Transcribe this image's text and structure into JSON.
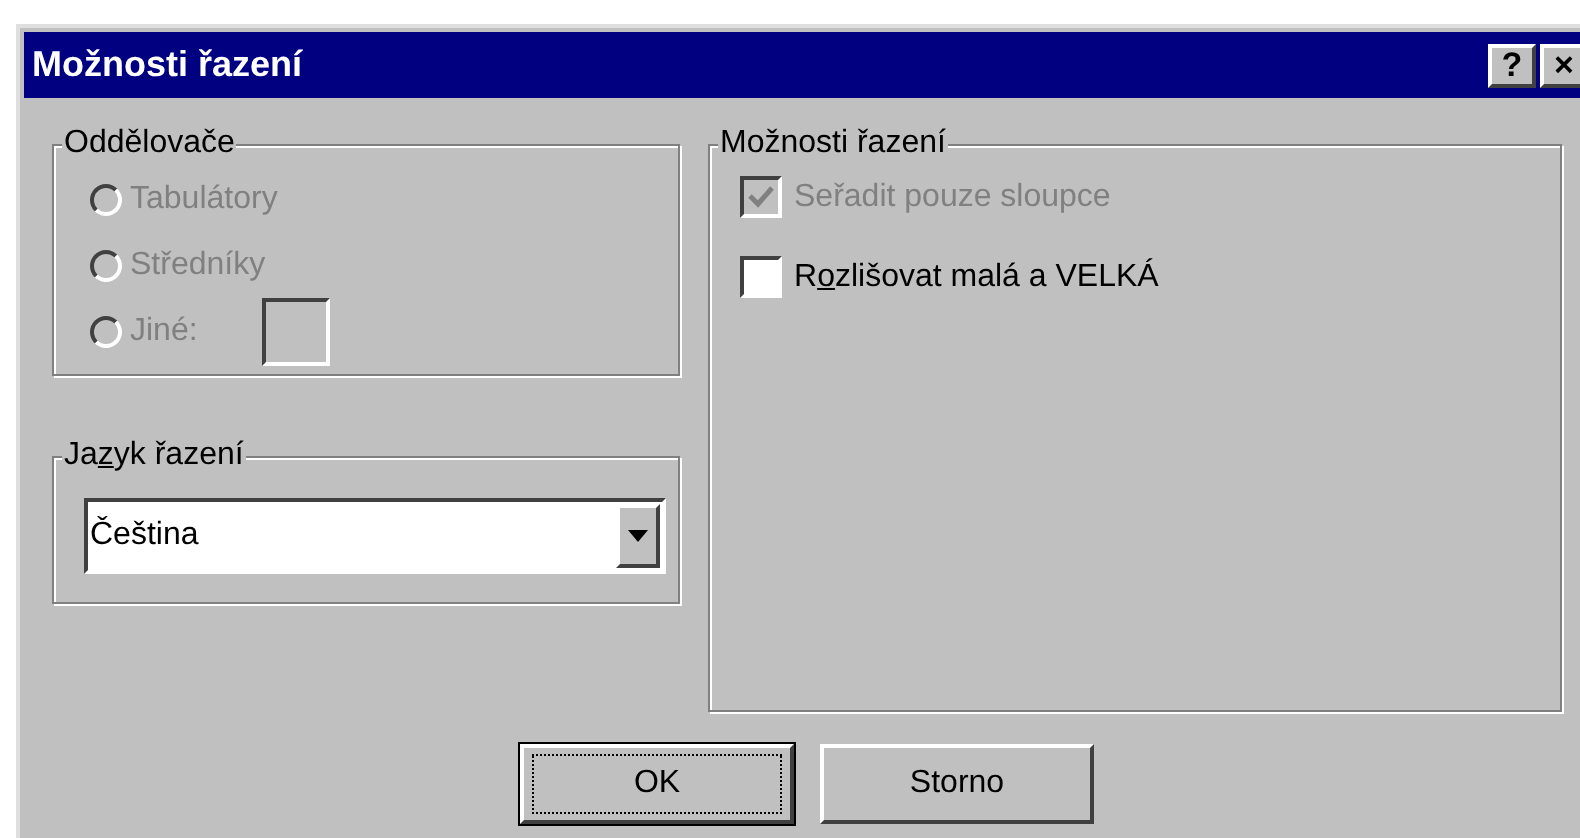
{
  "window": {
    "title": "Možnosti řazení",
    "title_buttons": [
      "?",
      "×"
    ]
  },
  "separators": {
    "title": "Oddělovače",
    "disabled": true,
    "options": [
      {
        "label": "Tabulátory",
        "selected": false
      },
      {
        "label": "Středníky",
        "selected": false
      },
      {
        "label": "Jiné:",
        "selected": false,
        "kind": "other"
      }
    ]
  },
  "sort_language": {
    "title": {
      "before": "Ja",
      "access_key": "z",
      "after": "yk řazení"
    },
    "value": "Čeština"
  },
  "sort_options": {
    "title": "Možnosti řazení",
    "options": [
      {
        "label": "Seřadit pouze sloupce",
        "checked": true,
        "disabled": true
      },
      {
        "label": {
          "before": "R",
          "access_key": "o",
          "after": "zlišovat malá a VELKÁ"
        },
        "checked": false,
        "disabled": false
      }
    ]
  },
  "buttons": [
    {
      "label": "OK",
      "default": true
    },
    {
      "label": "Storno",
      "default": false
    }
  ]
}
